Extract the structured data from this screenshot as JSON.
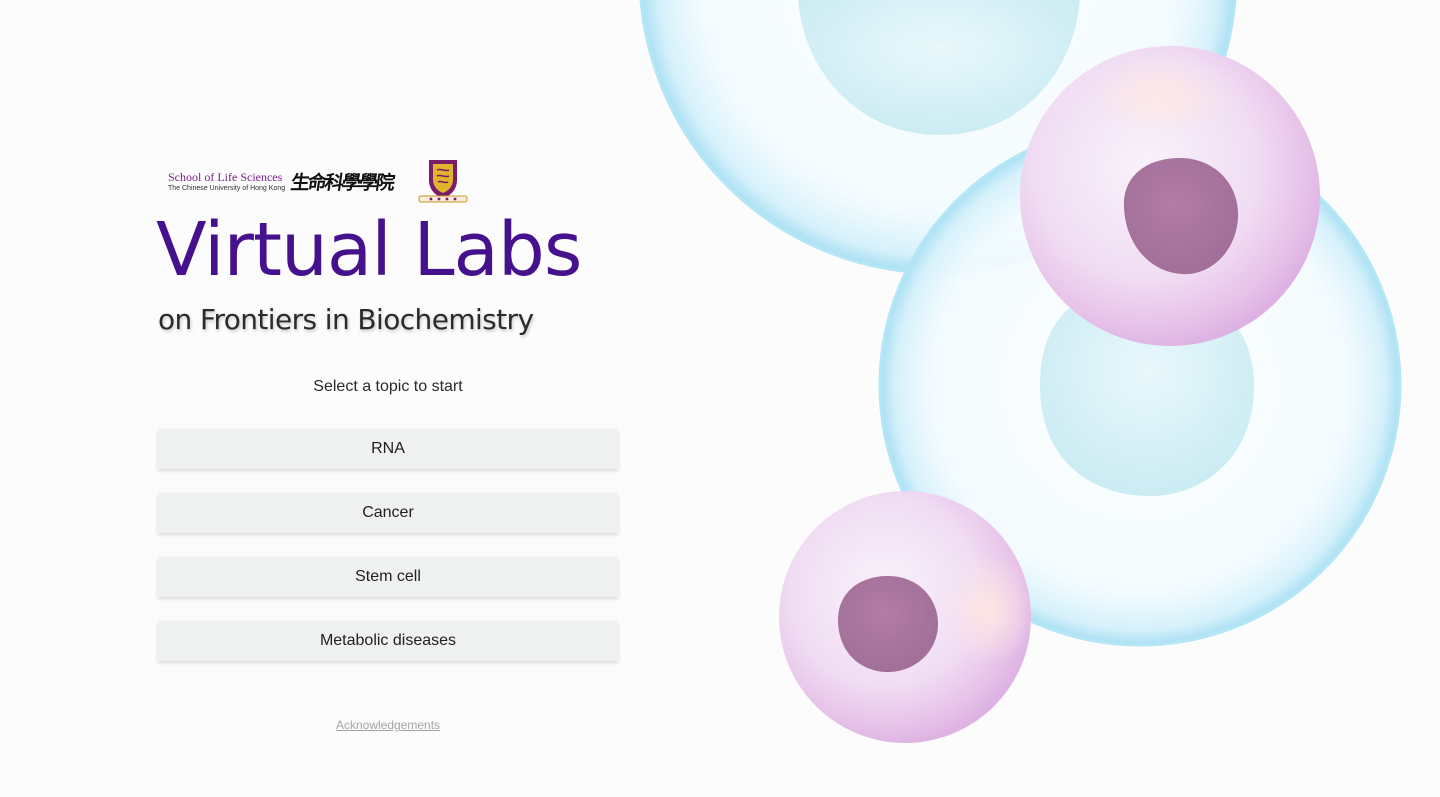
{
  "header": {
    "school_name_en": "School of  Life Sciences",
    "university_name": "The Chinese University of Hong Kong",
    "school_name_zh": "生命科學學院",
    "crest_icon": "cuhk-crest-icon"
  },
  "title": "Virtual Labs",
  "subtitle": "on Frontiers in Biochemistry",
  "prompt": "Select a topic to start",
  "topics": [
    {
      "label": "RNA"
    },
    {
      "label": "Cancer"
    },
    {
      "label": "Stem cell"
    },
    {
      "label": "Metabolic diseases"
    }
  ],
  "footer": {
    "acknowledgements_label": "Acknowledgements"
  },
  "colors": {
    "title": "#46118c",
    "school_name": "#7b1f8c",
    "button_bg": "#eff0f0",
    "cell_blue": "#8fd6ef",
    "cell_pink": "#e5b8e4",
    "nucleus": "#b07aa4"
  }
}
